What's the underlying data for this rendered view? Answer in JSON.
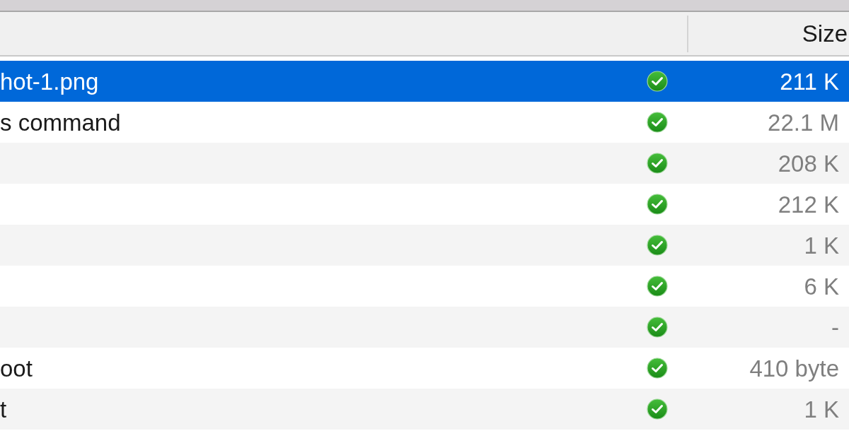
{
  "table": {
    "size_column": {
      "label": "Size"
    },
    "rows": [
      {
        "name": "hot-1.png",
        "size": "211 K",
        "selected": true
      },
      {
        "name": "s command",
        "size": "22.1 M",
        "selected": false
      },
      {
        "size": "208 K",
        "selected": false
      },
      {
        "size": "212 K",
        "selected": false
      },
      {
        "size": "1 K",
        "selected": false
      },
      {
        "size": "6 K",
        "selected": false
      },
      {
        "size": "-",
        "selected": false
      },
      {
        "name": "oot",
        "size": "410 byte",
        "selected": false
      },
      {
        "name": "t",
        "size": "1 K",
        "selected": false
      }
    ]
  }
}
